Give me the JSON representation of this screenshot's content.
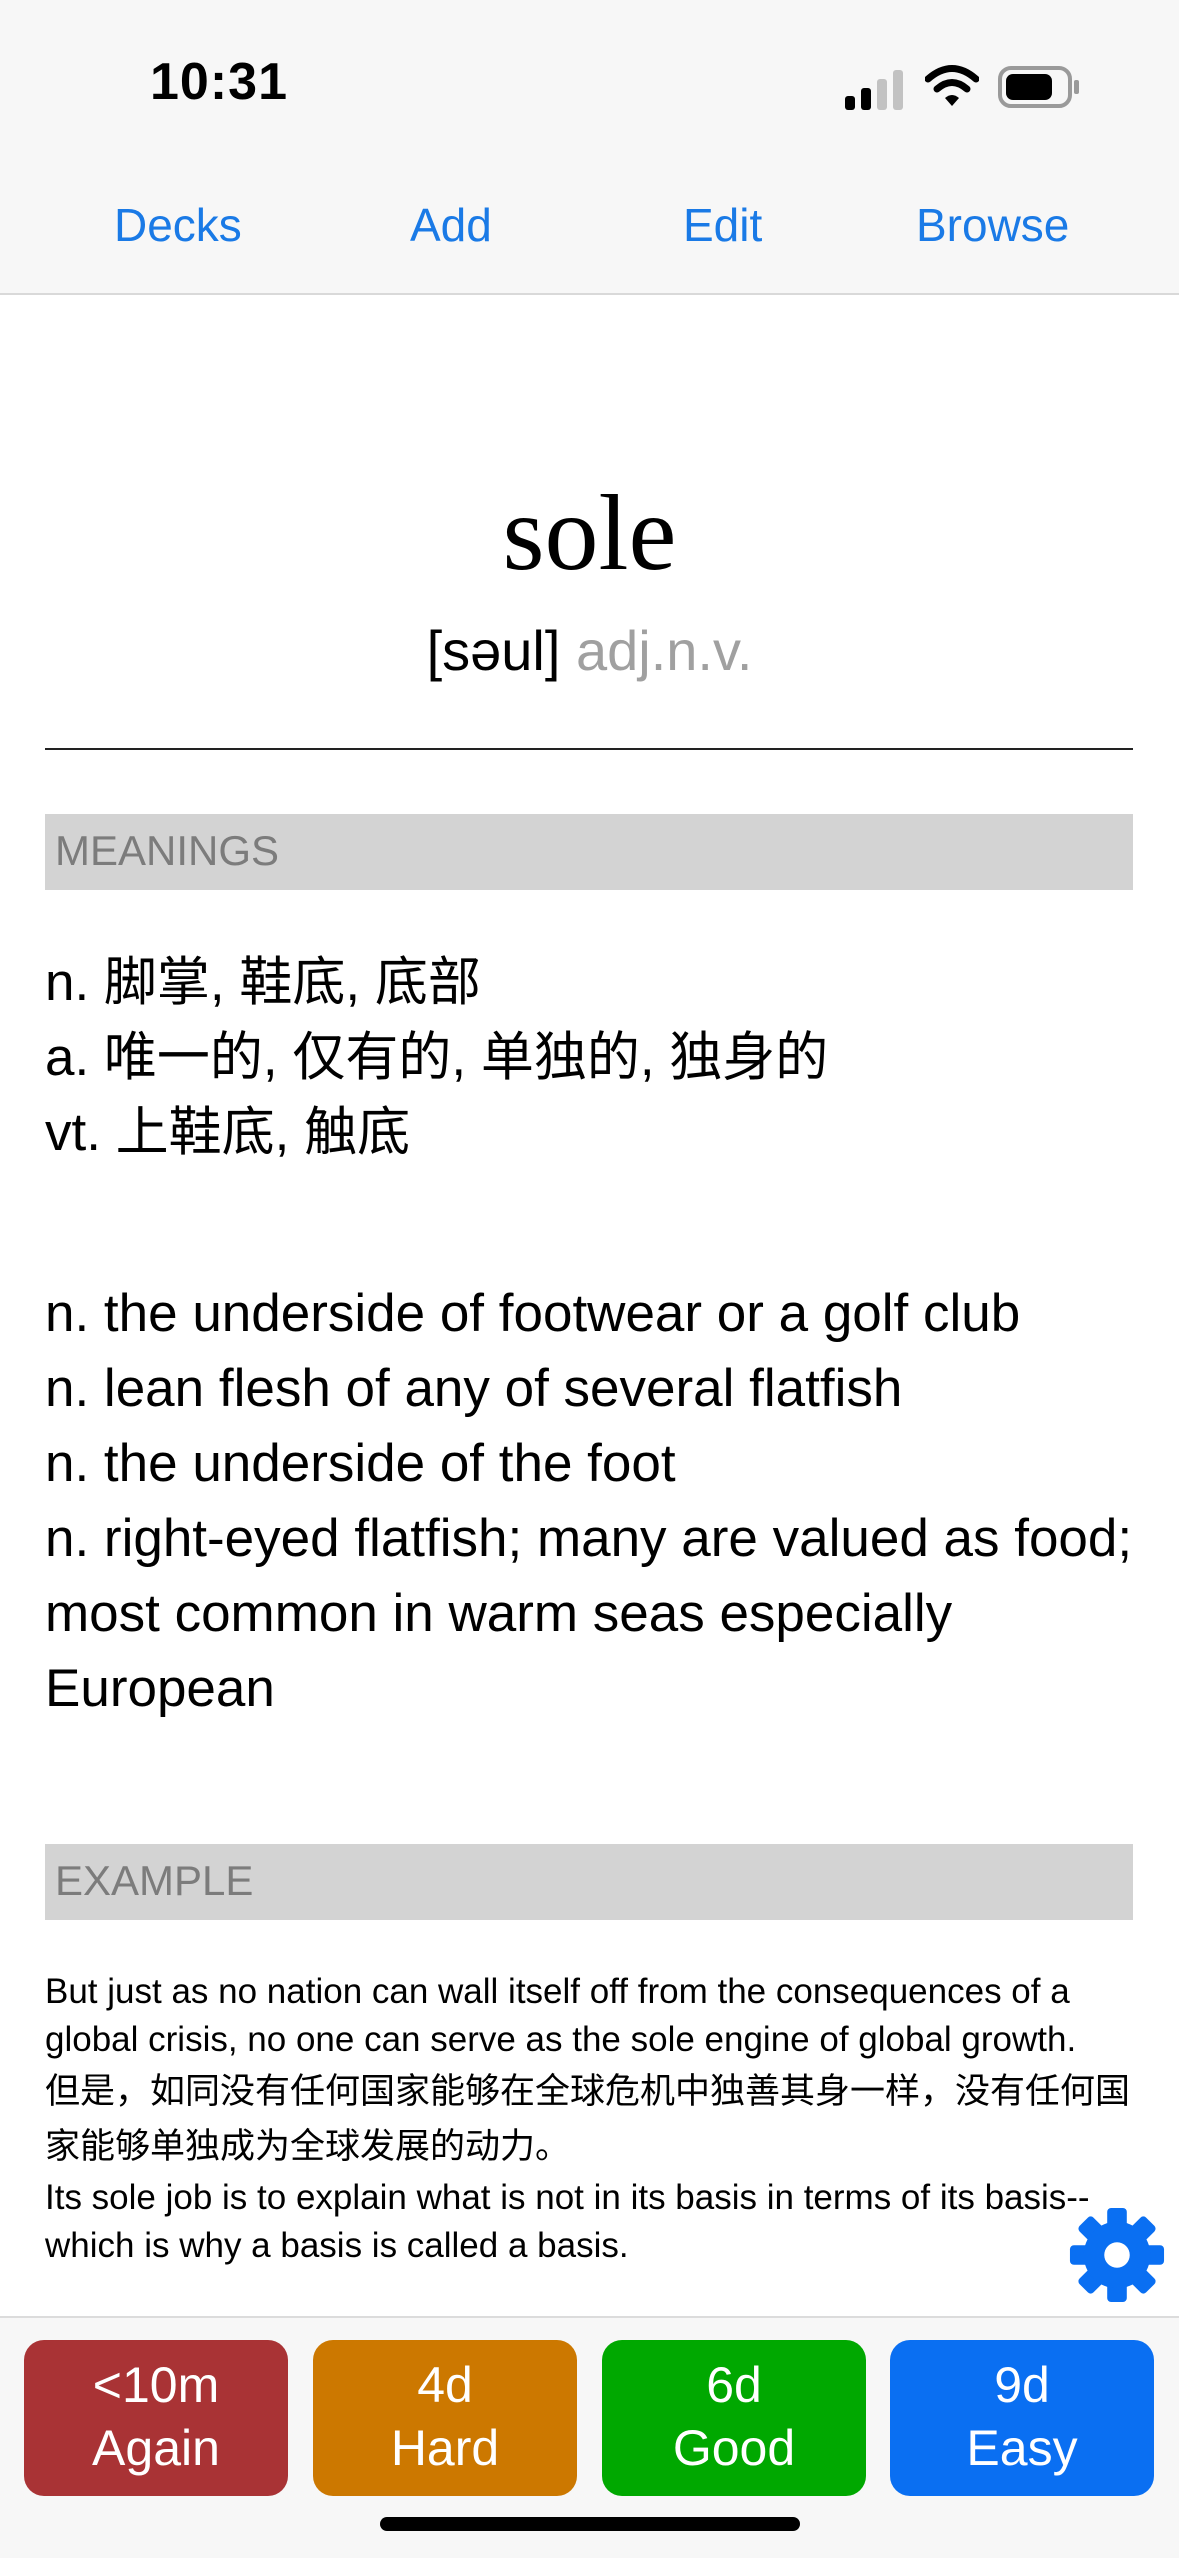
{
  "status": {
    "time": "10:31"
  },
  "nav": {
    "decks": "Decks",
    "add": "Add",
    "edit": "Edit",
    "browse": "Browse"
  },
  "card": {
    "word": "sole",
    "phonetic": "[səul]",
    "pos": "adj.n.v.",
    "meanings_header": "MEANINGS",
    "chinese_meanings": [
      "n. 脚掌, 鞋底, 底部",
      "a. 唯一的, 仅有的, 单独的, 独身的",
      "vt. 上鞋底, 触底"
    ],
    "english_definitions": [
      "n. the underside of footwear or a golf club",
      "n. lean flesh of any of several flatfish",
      "n. the underside of the foot",
      "n. right-eyed flatfish; many are valued as food; most common in warm seas especially European"
    ],
    "example_header": "EXAMPLE",
    "examples": [
      "But just as no nation can wall itself off from the consequences of a global crisis, no one can serve as the sole engine of global growth.",
      "但是，如同没有任何国家能够在全球危机中独善其身一样，没有任何国家能够单独成为全球发展的动力。",
      "Its sole job is to explain what is not in its basis in terms of its basis--which is why a basis is called a basis."
    ]
  },
  "answers": [
    {
      "interval": "<10m",
      "label": "Again",
      "color": "#a93335"
    },
    {
      "interval": "4d",
      "label": "Hard",
      "color": "#cc7800"
    },
    {
      "interval": "6d",
      "label": "Good",
      "color": "#00a800"
    },
    {
      "interval": "9d",
      "label": "Easy",
      "color": "#0a6ff2"
    }
  ],
  "colors": {
    "accent": "#1a7ae6",
    "gear": "#0a6ff2"
  }
}
